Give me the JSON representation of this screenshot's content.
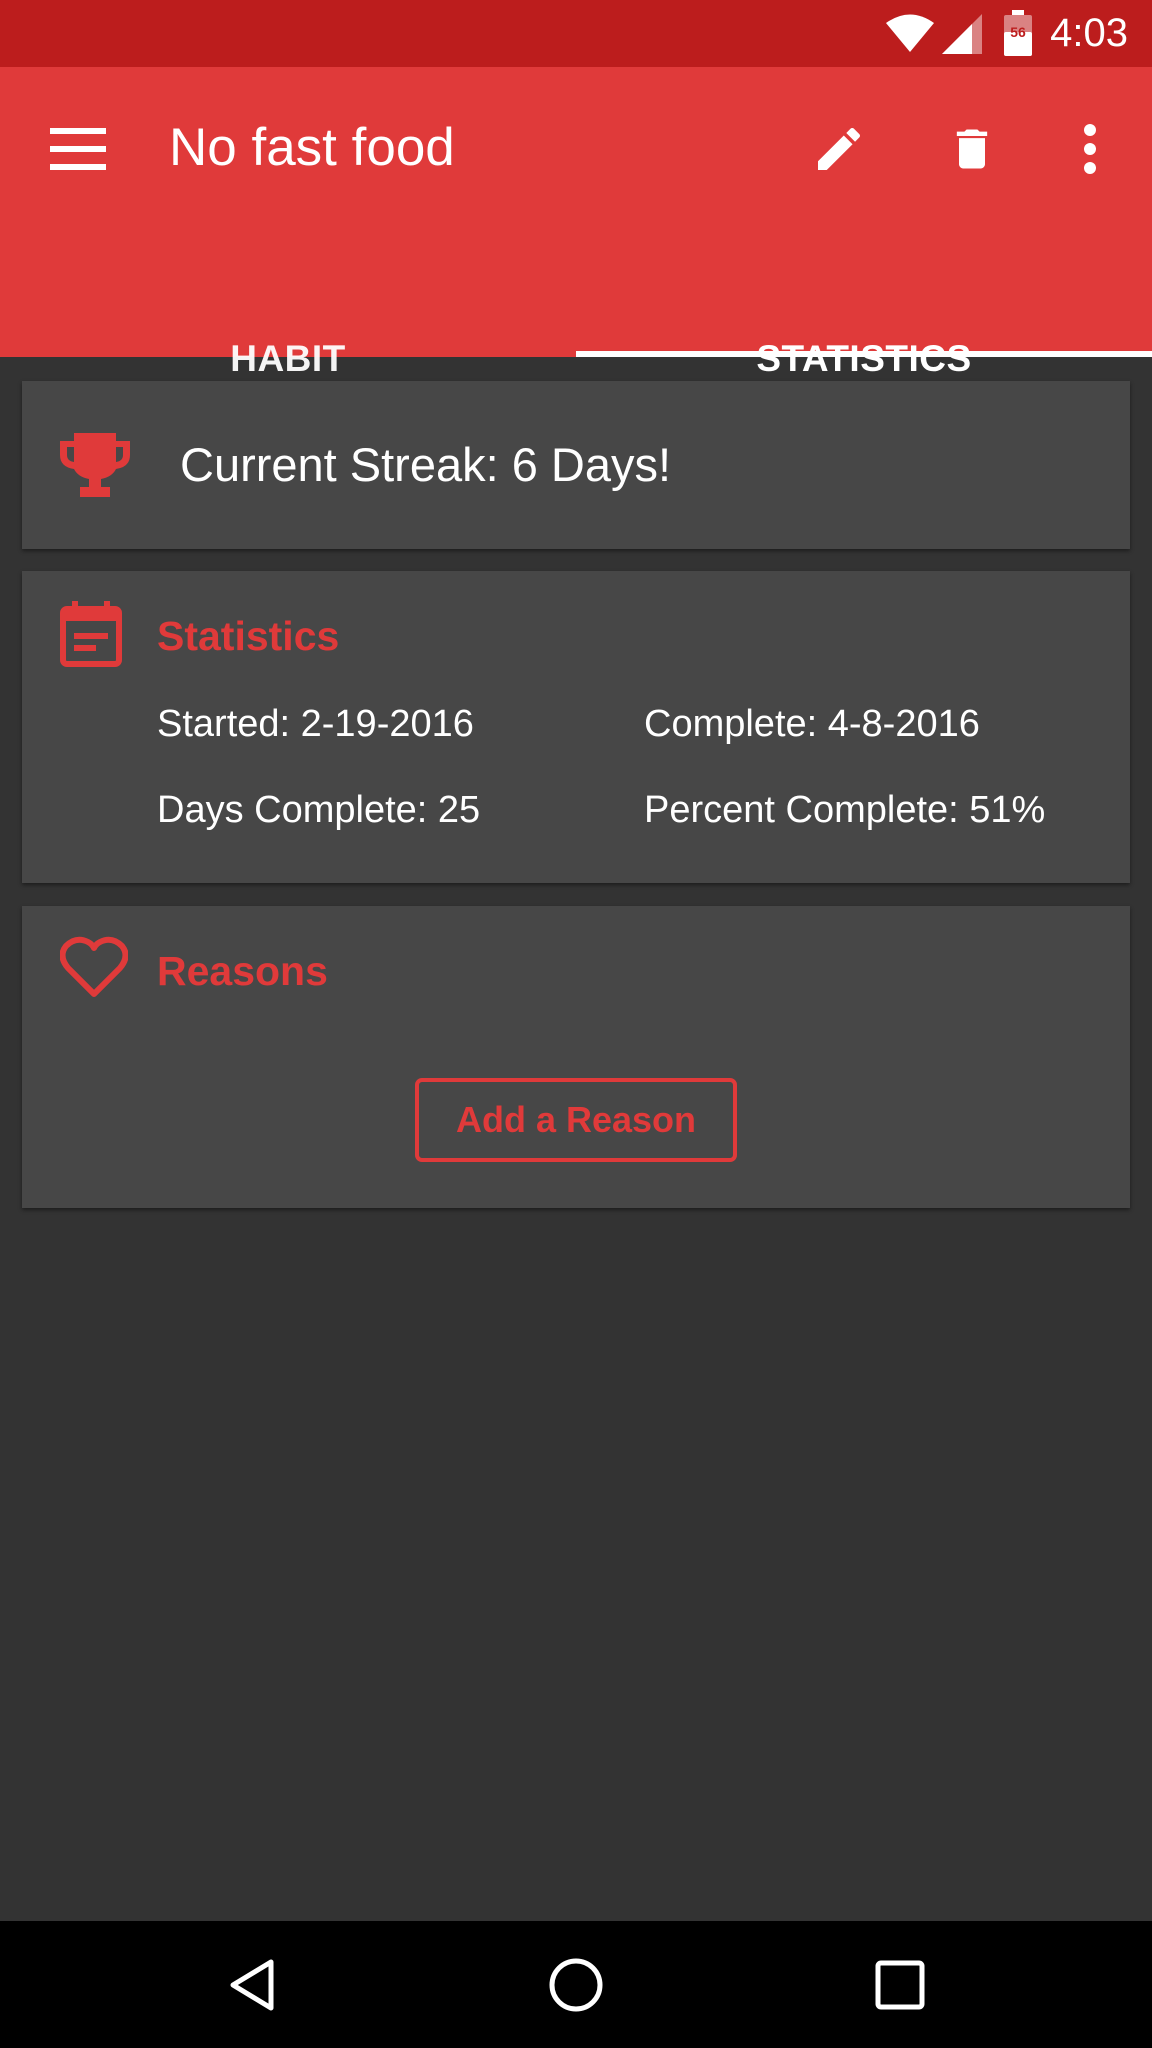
{
  "status_bar": {
    "time": "4:03",
    "battery_level": "56",
    "icons": [
      "wifi-icon",
      "cell-signal-icon",
      "battery-icon"
    ]
  },
  "toolbar": {
    "title": "No fast food",
    "actions": [
      "menu-icon",
      "edit-icon",
      "delete-icon",
      "more-vert-icon"
    ]
  },
  "tabs": [
    {
      "label": "HABIT",
      "selected": false
    },
    {
      "label": "STATISTICS",
      "selected": true
    }
  ],
  "streak": {
    "text": "Current Streak: 6 Days!",
    "icon": "trophy-icon"
  },
  "statistics": {
    "title": "Statistics",
    "icon": "calendar-icon",
    "started": "Started: 2-19-2016",
    "complete": "Complete: 4-8-2016",
    "days_complete": "Days Complete: 25",
    "percent_complete": "Percent Complete: 51%"
  },
  "reasons": {
    "title": "Reasons",
    "icon": "heart-icon",
    "add_button": "Add a Reason"
  },
  "nav_bar": [
    "back-icon",
    "home-icon",
    "recents-icon"
  ],
  "colors": {
    "primary": "#E03A3A",
    "primary_dark": "#BC1D1D",
    "background": "#333333",
    "card": "#474747",
    "text": "#FFFFFF"
  }
}
